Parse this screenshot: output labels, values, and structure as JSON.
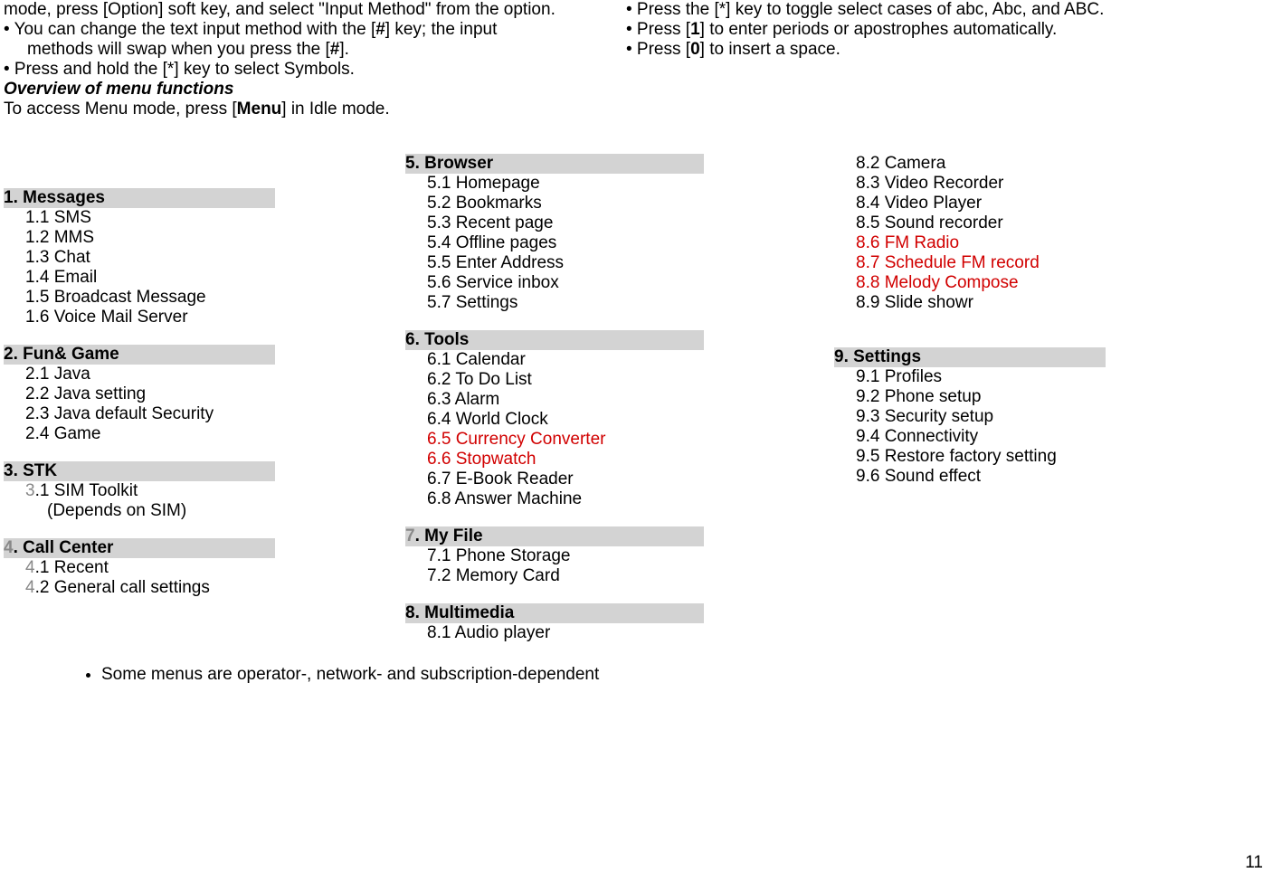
{
  "top": {
    "left": {
      "l1_pre": "mode, press [Option] soft key, and select \"Input Method\" from the option.",
      "l2_pre": "• You can change the text input method with the [",
      "l2_bold": "#",
      "l2_post": "] key; the input",
      "l3": "methods will swap when you press the [",
      "l3_bold": "#",
      "l3_post": "].",
      "l4": "• Press and hold the [*] key to select Symbols.",
      "overview": "Overview of menu functions",
      "access_pre": "To access Menu mode, press [",
      "access_bold": "Menu",
      "access_post": "] in Idle mode."
    },
    "right": {
      "r1": "• Press the [*] key to toggle select cases of abc, Abc, and ABC.",
      "r2_pre": "• Press [",
      "r2_bold": "1",
      "r2_post": "] to enter periods or apostrophes automatically.",
      "r3_pre": "• Press [",
      "r3_bold": "0",
      "r3_post": "] to insert a space."
    }
  },
  "menus": {
    "m1": {
      "title": "1. Messages",
      "i1": "1.1 SMS",
      "i2": "1.2 MMS",
      "i3": "1.3 Chat",
      "i4": "1.4 Email",
      "i5": "1.5 Broadcast Message",
      "i6": "1.6 Voice Mail Server"
    },
    "m2": {
      "title": "2. Fun& Game",
      "i1": "2.1 Java",
      "i2": "2.2 Java setting",
      "i3": "2.3 Java default Security",
      "i4": "2.4 Game"
    },
    "m3": {
      "title": "3. STK",
      "i1_g": "3",
      "i1_t": ".1 SIM Toolkit",
      "i1_sub": "(Depends on SIM)"
    },
    "m4": {
      "title_g": "4",
      "title_t": ". Call Center",
      "i1_g": "4",
      "i1_t": ".1 Recent",
      "i2_g": "4",
      "i2_t": ".2 General call settings"
    },
    "m5": {
      "title": "5. Browser",
      "i1": "5.1 Homepage",
      "i2": "5.2 Bookmarks",
      "i3": "5.3 Recent page",
      "i4": "5.4 Offline pages",
      "i5": "5.5 Enter Address",
      "i6": "5.6 Service inbox",
      "i7": "5.7 Settings"
    },
    "m6": {
      "title": "6. Tools",
      "i1": "6.1 Calendar",
      "i2": "6.2 To Do List",
      "i3": "6.3 Alarm",
      "i4": "6.4 World Clock",
      "i5": "6.5 Currency Converter",
      "i6": "6.6 Stopwatch",
      "i7": "6.7 E-Book Reader",
      "i8": "6.8 Answer Machine"
    },
    "m7": {
      "title_g": "7",
      "title_t": ". My File",
      "i1": "7.1 Phone Storage",
      "i2": "7.2 Memory Card"
    },
    "m8": {
      "title": "8. Multimedia",
      "i1": "8.1 Audio player",
      "i2": "8.2 Camera",
      "i3": "8.3 Video Recorder",
      "i4": "8.4 Video Player",
      "i5": "8.5 Sound recorder",
      "i6": "8.6 FM Radio",
      "i7": "8.7 Schedule FM record",
      "i8": "8.8 Melody Compose",
      "i9": "8.9 Slide showr"
    },
    "m9": {
      "title": "9. Settings",
      "i1": "9.1 Profiles",
      "i2": "9.2 Phone setup",
      "i3": "9.3 Security setup",
      "i4": "9.4 Connectivity",
      "i5": "9.5 Restore factory setting",
      "i6": "9.6 Sound effect"
    }
  },
  "footnote": "Some menus are operator-, network- and subscription-dependent",
  "page_num": "11"
}
